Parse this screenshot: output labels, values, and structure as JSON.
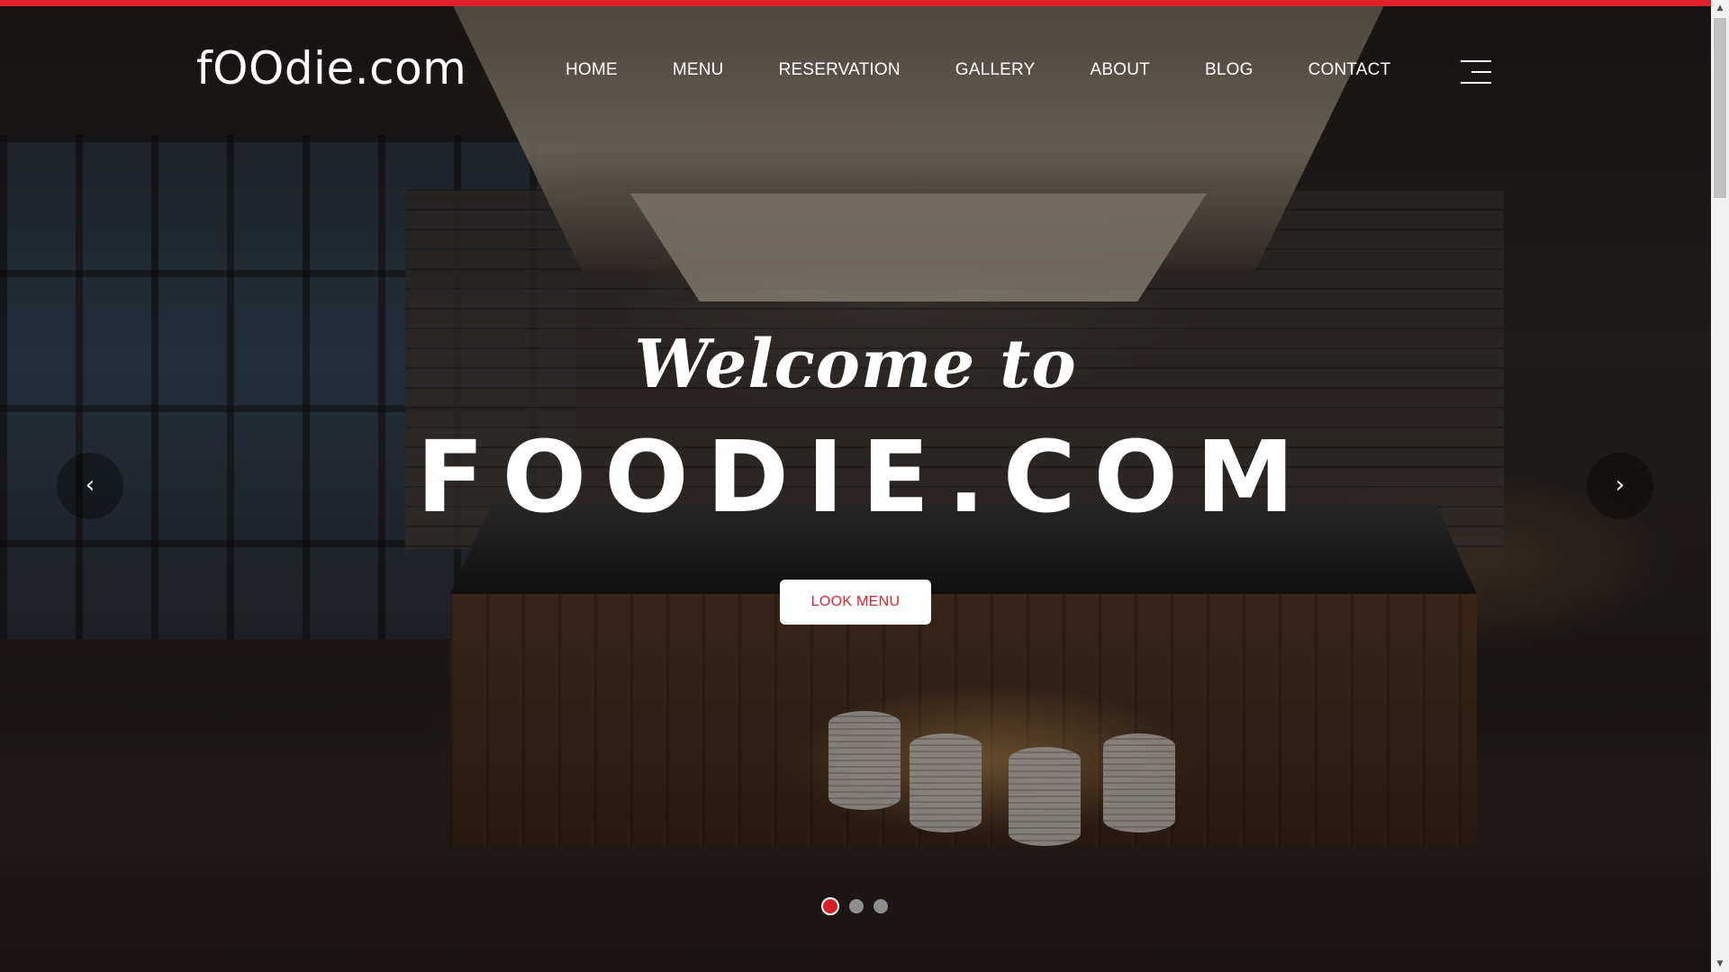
{
  "header": {
    "logo": "fOOdie.com",
    "nav": [
      "HOME",
      "MENU",
      "RESERVATION",
      "GALLERY",
      "ABOUT",
      "BLOG",
      "CONTACT"
    ],
    "menu_icon": "hamburger-icon"
  },
  "hero": {
    "eyebrow": "Welcome to",
    "title": "FOODIE.COM",
    "cta_label": "LOOK MENU",
    "prev_icon": "chevron-left-icon",
    "next_icon": "chevron-right-icon",
    "prev_glyph": "‹",
    "next_glyph": "›",
    "slides_total": 3,
    "active_slide": 1
  },
  "scrollbar": {
    "up_glyph": "▲",
    "down_glyph": "▼"
  },
  "colors": {
    "accent": "#e0232a",
    "text": "#ffffff",
    "cta_background": "#ffffff",
    "dot_active": "#d81f26",
    "dot_inactive": "#8e8e8e"
  }
}
